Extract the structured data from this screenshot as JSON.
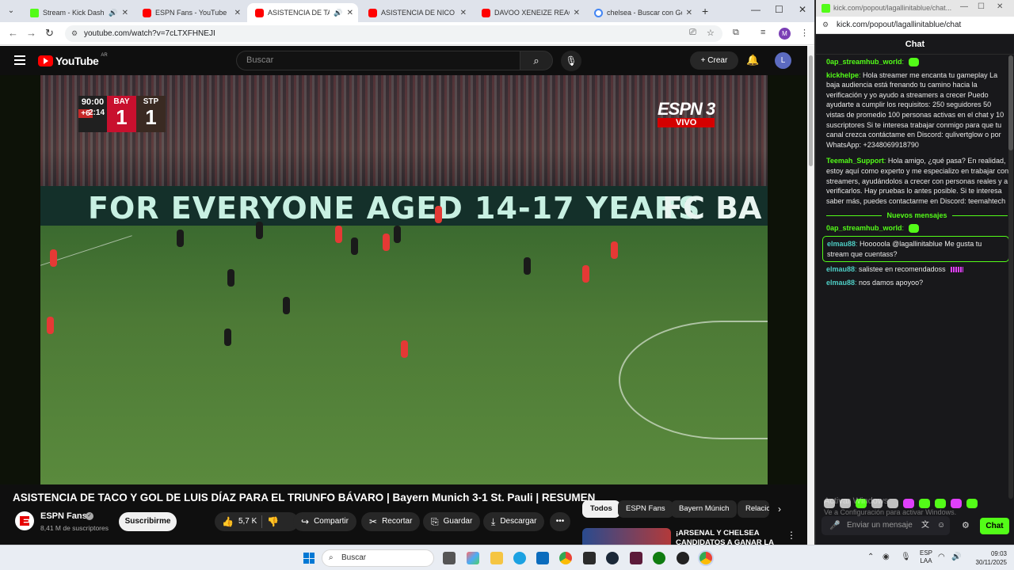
{
  "browser": {
    "tabs": [
      {
        "title": "Stream - Kick Dashboard",
        "favicon": "kick-icon",
        "audio": true,
        "active": false
      },
      {
        "title": "ESPN Fans - YouTube",
        "favicon": "youtube-icon",
        "audio": false,
        "active": false
      },
      {
        "title": "ASISTENCIA DE TACO Y GOL",
        "favicon": "youtube-icon",
        "audio": true,
        "active": true
      },
      {
        "title": "ASISTENCIA DE NICO PAZ",
        "favicon": "youtube-icon",
        "audio": false,
        "active": false
      },
      {
        "title": "DAVOO XENEIZE REACCIONA",
        "favicon": "youtube-icon",
        "audio": false,
        "active": false
      },
      {
        "title": "chelsea - Buscar con Google",
        "favicon": "google-icon",
        "audio": false,
        "active": false
      }
    ],
    "url": "youtube.com/watch?v=7cLTXFHNEJI",
    "profile_initial": "M"
  },
  "youtube": {
    "logo_text": "YouTube",
    "country_code": "AR",
    "search_placeholder": "Buscar",
    "create_label": "Crear",
    "avatar_initial": "L",
    "video": {
      "scoreboard": {
        "clock": "90:00",
        "added_time": "+6",
        "elapsed": "2:14",
        "home_abbr": "BAY",
        "home_score": "1",
        "away_abbr": "STP",
        "away_score": "1"
      },
      "broadcaster": "ESPN 3",
      "live_label": "VIVO",
      "banner_text": "FOR EVERYONE AGED 14-17 YEARS",
      "banner_text_2": "FC BA"
    },
    "title": "ASISTENCIA DE TACO Y GOL DE LUIS DÍAZ PARA EL TRIUNFO BÁVARO | Bayern Munich 3-1 St. Pauli | RESUMEN",
    "channel": {
      "name": "ESPN Fans",
      "subscribers": "8,41 M de suscriptores",
      "subscribe_label": "Suscribirme"
    },
    "actions": {
      "likes": "5,7 K",
      "share": "Compartir",
      "clip": "Recortar",
      "save": "Guardar",
      "download": "Descargar"
    },
    "chips": [
      "Todos",
      "ESPN Fans",
      "Bayern Múnich",
      "Relacionado"
    ],
    "related": {
      "title": "¡ARSENAL Y CHELSEA CANDIDATOS A GANAR LA"
    }
  },
  "kick": {
    "window_url": "kick.com/popout/lagallinitablue/chat...",
    "url": "kick.com/popout/lagallinitablue/chat",
    "header": "Chat",
    "messages": [
      {
        "user": "0ap_streamhub_world",
        "color": "#53fc18",
        "text": ""
      },
      {
        "user": "kickhelpe",
        "color": "#53fc18",
        "text": "Hola streamer me encanta tu gameplay La baja audiencia está frenando tu camino hacia la verificación y yo ayudo a streamers a crecer Puedo ayudarte a cumplir los requisitos: 250 seguidores 50 vistas de promedio 100 personas activas en el chat y 10 suscriptores Si te interesa trabajar conmigo para que tu canal crezca contáctame en Discord: qulivertglow o por WhatsApp: +2348069918790"
      },
      {
        "user": "Teemah_Support",
        "color": "#53fc18",
        "text": "Hola amigo, ¿qué pasa? En realidad, estoy aquí como experto y me especializo en trabajar con streamers, ayudándolos a crecer con personas reales y a verificarlos. Hay pruebas lo antes posible. Si te interesa saber más, puedes contactarme en Discord: teemahtech"
      }
    ],
    "new_messages_label": "Nuevos mensajes",
    "new_messages": [
      {
        "user": "0ap_streamhub_world",
        "color": "#53fc18",
        "text": ""
      },
      {
        "user": "elmau88",
        "color": "#4ecdc4",
        "text": "Hooooola @lagallinitablue Me gusta tu stream que cuentass?"
      },
      {
        "user": "elmau88",
        "color": "#4ecdc4",
        "text": "salistee en recomendadoss"
      },
      {
        "user": "elmau88",
        "color": "#4ecdc4",
        "text": "nos damos apoyoo?"
      }
    ],
    "watermark_1": "Activar Windows",
    "watermark_2": "Ve a Configuración para activar Windows.",
    "input_placeholder": "Enviar un mensaje",
    "send_label": "Chat",
    "accent": "#53fc18"
  },
  "taskbar": {
    "search_placeholder": "Buscar",
    "language": "ESP",
    "layout": "LAA",
    "time": "09:03",
    "date": "30/11/2025"
  }
}
